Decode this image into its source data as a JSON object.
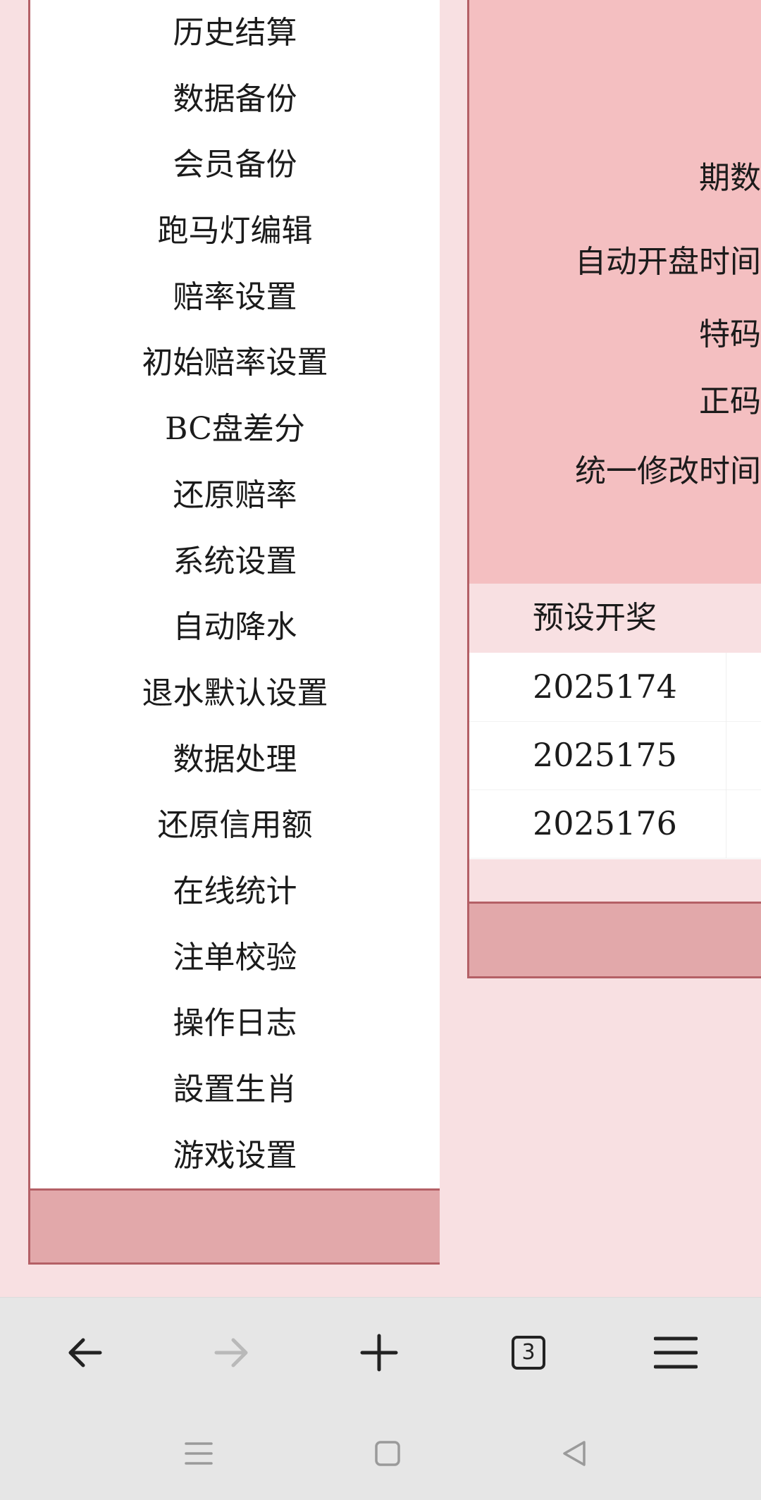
{
  "menu": {
    "items": [
      "历史结算",
      "数据备份",
      "会员备份",
      "跑马灯编辑",
      "赔率设置",
      "初始赔率设置",
      "BC盘差分",
      "还原赔率",
      "系统设置",
      "自动降水",
      "退水默认设置",
      "数据处理",
      "还原信用额",
      "在线统计",
      "注单校验",
      "操作日志",
      "設置生肖",
      "游戏设置"
    ]
  },
  "settings": {
    "labels": [
      "期数",
      "自动开盘时间",
      "特码",
      "正码",
      "统一修改时间"
    ]
  },
  "table": {
    "header": "预设开奖",
    "rows": [
      "2025174",
      "2025175",
      "2025176"
    ]
  },
  "browser": {
    "tab_count": "3"
  },
  "colors": {
    "page_bg": "#f8e0e2",
    "settings_bg": "#f4bfc1",
    "footer_bg": "#e2a8aa",
    "border": "#b46066"
  }
}
